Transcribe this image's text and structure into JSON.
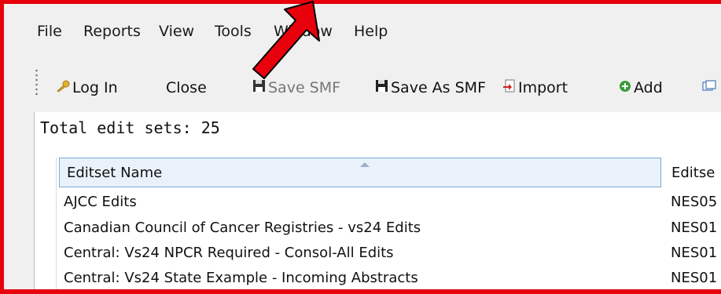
{
  "menu": {
    "items": [
      "File",
      "Reports",
      "View",
      "Tools",
      "Window",
      "Help"
    ]
  },
  "toolbar": {
    "buttons": [
      {
        "label": "Log In",
        "icon": "key-icon",
        "enabled": true
      },
      {
        "label": "Close",
        "icon": "",
        "enabled": true
      },
      {
        "label": "Save SMF",
        "icon": "floppy-disk-icon",
        "enabled": false
      },
      {
        "label": "Save As SMF",
        "icon": "floppy-disk-icon",
        "enabled": true
      },
      {
        "label": "Import",
        "icon": "import-icon",
        "enabled": true
      },
      {
        "label": "Add",
        "icon": "add-circle-icon",
        "enabled": true
      }
    ]
  },
  "summary": {
    "total_label": "Total edit sets: 25"
  },
  "grid": {
    "columns": [
      "Editset Name",
      "Editse"
    ],
    "rows": [
      [
        "AJCC Edits",
        "NES05"
      ],
      [
        "Canadian Council of Cancer Registries - vs24 Edits",
        "NES01"
      ],
      [
        "Central: Vs24 NPCR Required - Consol-All Edits",
        "NES01"
      ],
      [
        "Central: Vs24 State Example - Incoming Abstracts",
        "NES01"
      ]
    ]
  },
  "colors": {
    "highlight_border": "#e8000c",
    "arrow": "#e8000c"
  }
}
